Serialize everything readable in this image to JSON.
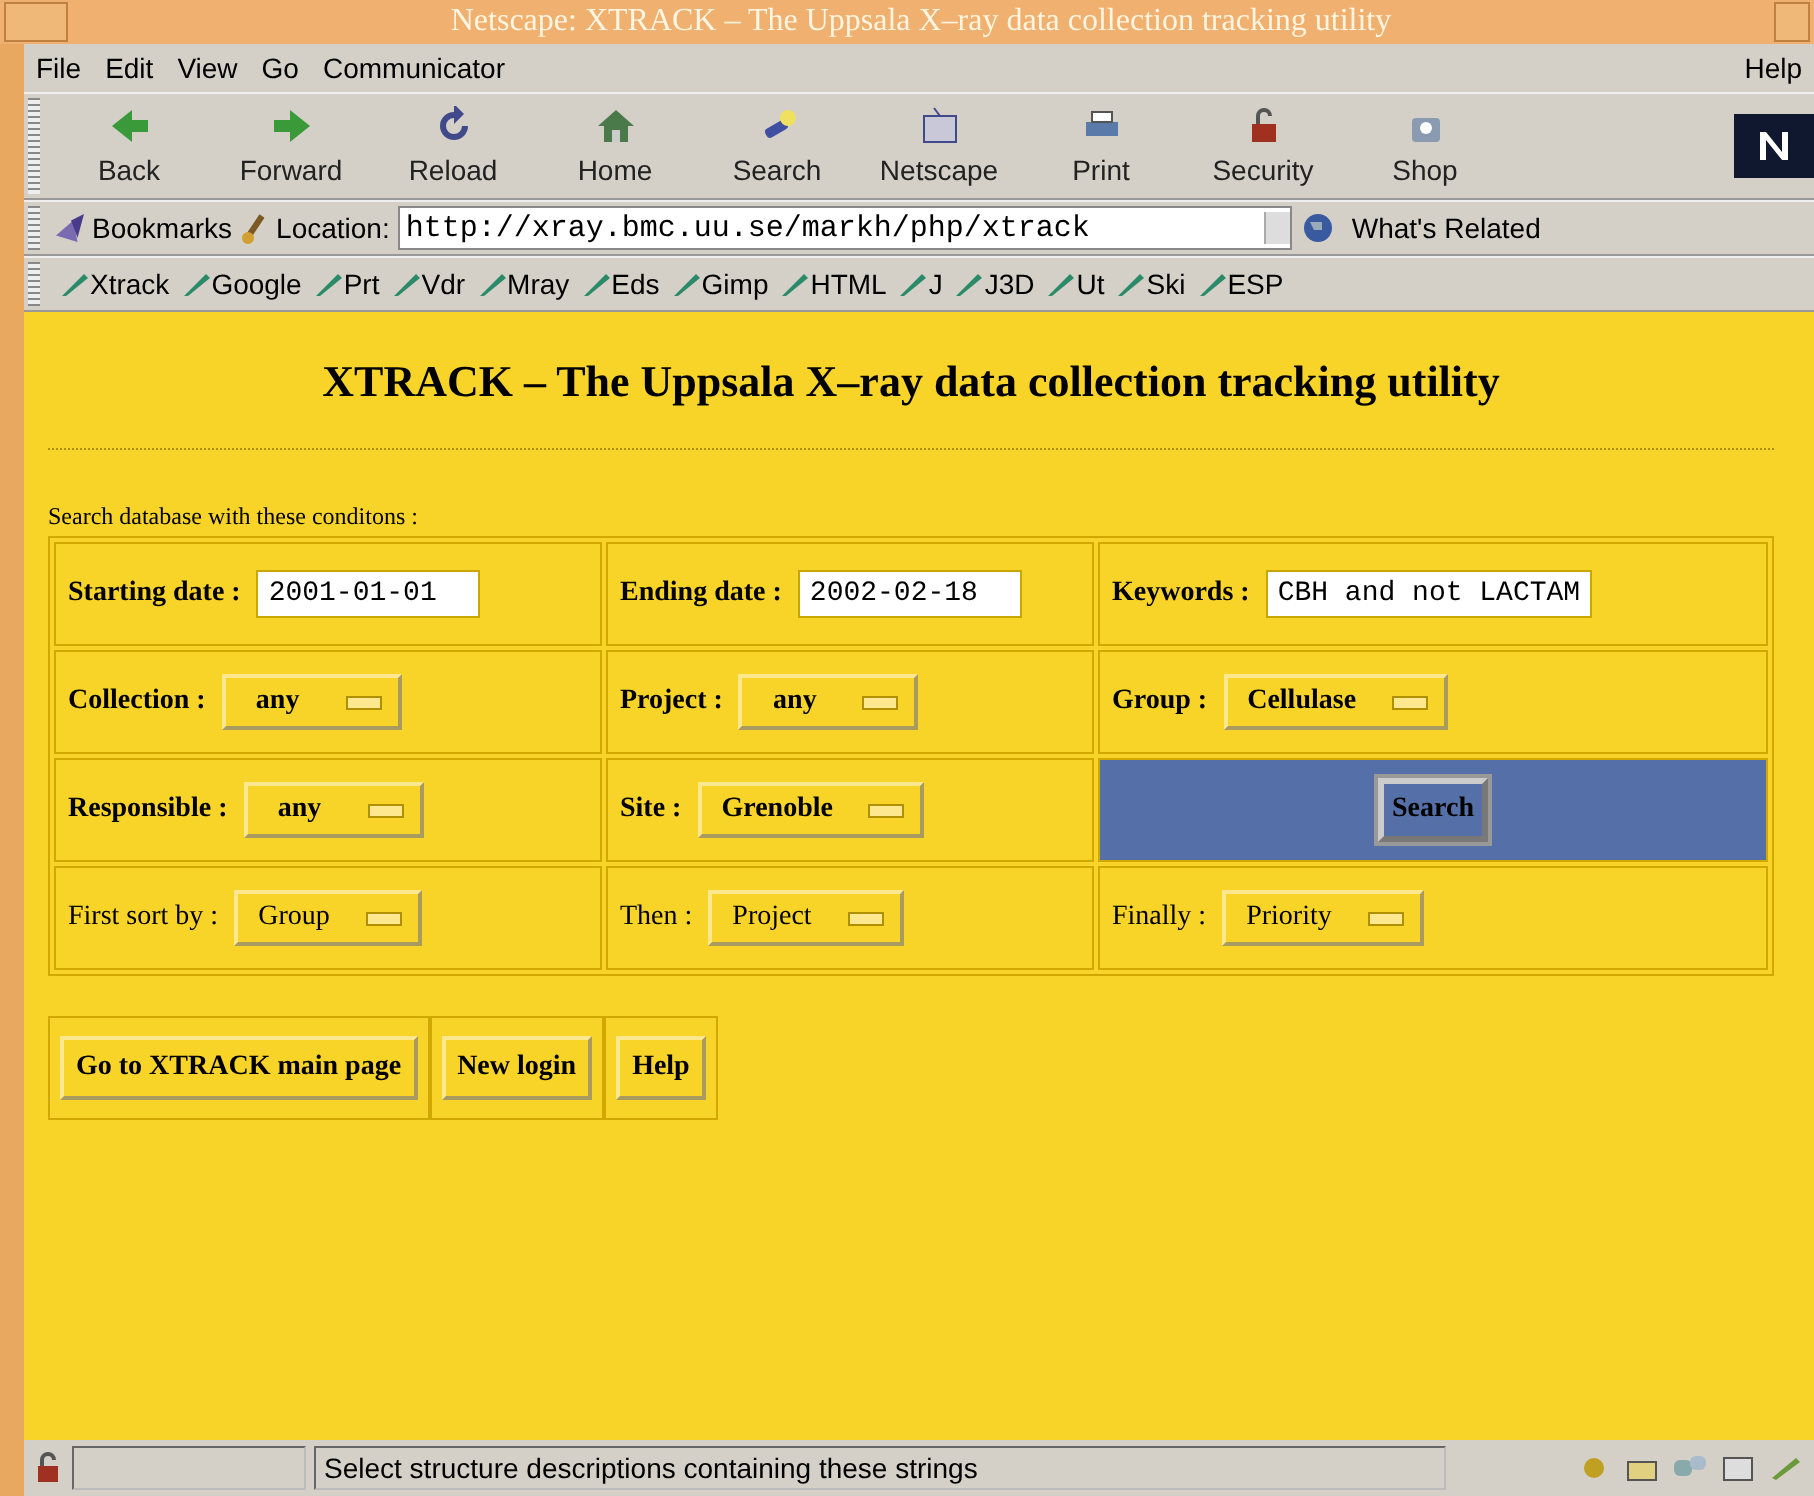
{
  "window": {
    "title": "Netscape: XTRACK – The Uppsala X–ray data collection tracking utility"
  },
  "menu": {
    "items": [
      "File",
      "Edit",
      "View",
      "Go",
      "Communicator"
    ],
    "help": "Help"
  },
  "toolbar": [
    "Back",
    "Forward",
    "Reload",
    "Home",
    "Search",
    "Netscape",
    "Print",
    "Security",
    "Shop"
  ],
  "location_bar": {
    "bookmarks": "Bookmarks",
    "label": "Location:",
    "url": "http://xray.bmc.uu.se/markh/php/xtrack",
    "related": "What's Related"
  },
  "personal_toolbar": [
    "Xtrack",
    "Google",
    "Prt",
    "Vdr",
    "Mray",
    "Eds",
    "Gimp",
    "HTML",
    "J",
    "J3D",
    "Ut",
    "Ski",
    "ESP"
  ],
  "page": {
    "heading": "XTRACK – The Uppsala X–ray data collection tracking utility",
    "intro": "Search database with these conditons :",
    "rows": [
      {
        "kind": "criteria",
        "cells": [
          {
            "kind": "input",
            "label": "Starting date :",
            "value": "2001-01-01"
          },
          {
            "kind": "input",
            "label": "Ending date :",
            "value": "2002-02-18"
          },
          {
            "kind": "input",
            "label": "Keywords :",
            "value": "CBH and not LACTAM"
          }
        ]
      },
      {
        "kind": "criteria",
        "cells": [
          {
            "kind": "select",
            "label": "Collection :",
            "value": "any"
          },
          {
            "kind": "select",
            "label": "Project :",
            "value": "any"
          },
          {
            "kind": "select",
            "label": "Group :",
            "value": "Cellulase"
          }
        ]
      },
      {
        "kind": "criteria",
        "cells": [
          {
            "kind": "select",
            "label": "Responsible :",
            "value": "any"
          },
          {
            "kind": "select",
            "label": "Site :",
            "value": "Grenoble"
          },
          {
            "kind": "button",
            "value": "Search"
          }
        ]
      },
      {
        "kind": "sort",
        "cells": [
          {
            "kind": "select",
            "label": "First sort by :",
            "value": "Group"
          },
          {
            "kind": "select",
            "label": "Then :",
            "value": "Project"
          },
          {
            "kind": "select",
            "label": "Finally :",
            "value": "Priority"
          }
        ]
      }
    ],
    "buttons": [
      "Go to XTRACK main page",
      "New login",
      "Help"
    ]
  },
  "status_bar": {
    "text": "Select structure descriptions containing these strings"
  }
}
